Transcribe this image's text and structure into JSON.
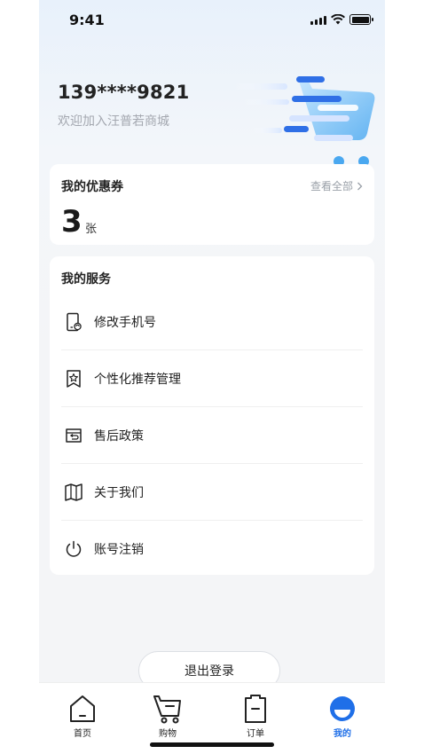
{
  "status_bar": {
    "time": "9:41"
  },
  "profile": {
    "phone": "139****9821",
    "welcome": "欢迎加入汪普若商城"
  },
  "coupon": {
    "title": "我的优惠券",
    "view_all": "查看全部",
    "count": "3",
    "unit": "张"
  },
  "services": {
    "title": "我的服务",
    "items": [
      {
        "label": "修改手机号",
        "icon": "phone-refresh-icon"
      },
      {
        "label": "个性化推荐管理",
        "icon": "star-badge-icon"
      },
      {
        "label": "售后政策",
        "icon": "return-box-icon"
      },
      {
        "label": "关于我们",
        "icon": "map-icon"
      },
      {
        "label": "账号注销",
        "icon": "power-icon"
      }
    ]
  },
  "logout": {
    "label": "退出登录"
  },
  "tabs": [
    {
      "label": "首页",
      "icon": "home-icon",
      "active": false
    },
    {
      "label": "购物",
      "icon": "cart-icon",
      "active": false
    },
    {
      "label": "订单",
      "icon": "order-icon",
      "active": false
    },
    {
      "label": "我的",
      "icon": "profile-icon",
      "active": true
    }
  ],
  "colors": {
    "accent": "#1f6fe8",
    "background": "#f4f5f7",
    "card": "#ffffff"
  }
}
